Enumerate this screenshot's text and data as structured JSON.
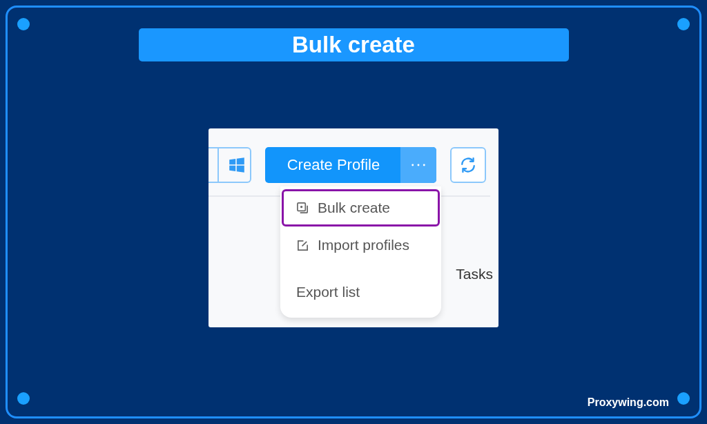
{
  "title": "Bulk create",
  "screenshot": {
    "primary_button": "Create Profile",
    "menu": [
      {
        "label": "Bulk create",
        "kind": "bulk",
        "selected": true
      },
      {
        "label": "Import profiles",
        "kind": "import",
        "selected": false
      },
      {
        "label": "Export list",
        "kind": "export",
        "selected": false
      }
    ],
    "tasks_label": "Tasks"
  },
  "footer": "Proxywing.com"
}
